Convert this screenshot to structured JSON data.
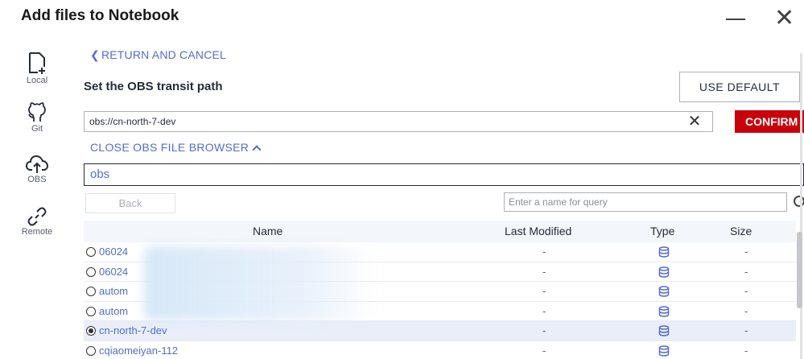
{
  "window": {
    "title": "Add files to Notebook",
    "minimize": "minimize",
    "close_glyph": "✕"
  },
  "sidebar": {
    "items": [
      {
        "label": "Local",
        "icon": "file-add-icon"
      },
      {
        "label": "Git",
        "icon": "github-icon"
      },
      {
        "label": "OBS",
        "icon": "cloud-upload-icon"
      },
      {
        "label": "Remote",
        "icon": "link-icon"
      }
    ]
  },
  "main": {
    "return_link": "RETURN AND CANCEL",
    "section_title": "Set the OBS transit path",
    "use_default_label": "USE DEFAULT",
    "path_value": "obs://cn-north-7-dev",
    "confirm_label": "CONFIRM",
    "close_browser_label": "CLOSE OBS FILE BROWSER",
    "bucket_value": "obs",
    "back_label": "Back",
    "query_placeholder": "Enter a name for query"
  },
  "table": {
    "headers": {
      "name": "Name",
      "modified": "Last Modified",
      "type": "Type",
      "size": "Size"
    },
    "rows": [
      {
        "name": "06024",
        "modified": "-",
        "size": "-",
        "selected": false
      },
      {
        "name": "06024",
        "modified": "-",
        "size": "-",
        "selected": false
      },
      {
        "name": "autom",
        "modified": "-",
        "size": "-",
        "selected": false
      },
      {
        "name": "autom",
        "modified": "-",
        "size": "-",
        "selected": false
      },
      {
        "name": "cn-north-7-dev",
        "modified": "-",
        "size": "-",
        "selected": true
      },
      {
        "name": "cqiaomeiyan-112",
        "modified": "-",
        "size": "-",
        "selected": false
      }
    ]
  },
  "colors": {
    "accent": "#526ecc",
    "confirm": "#c7000b",
    "selected_row": "#e9eef9"
  }
}
